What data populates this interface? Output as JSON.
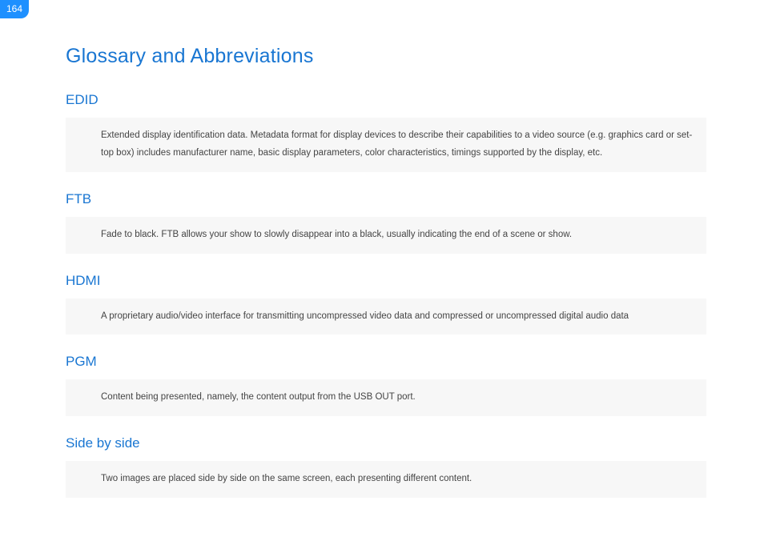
{
  "page_number": "164",
  "title": "Glossary and Abbreviations",
  "entries": [
    {
      "term": "EDID",
      "definition": "Extended display identification data. Metadata format for display devices to describe their capabilities to a video source (e.g. graphics card or set-top box) includes manufacturer name, basic display parameters, color characteristics, timings supported by the display, etc."
    },
    {
      "term": "FTB",
      "definition": "Fade to black. FTB allows your show to slowly disappear into a black, usually indicating the end of a scene or show."
    },
    {
      "term": "HDMI",
      "definition": "A proprietary audio/video interface for transmitting uncompressed video data and compressed or uncompressed digital audio data"
    },
    {
      "term": "PGM",
      "definition": "Content being presented, namely, the content output from the USB OUT port."
    },
    {
      "term": "Side by side",
      "definition": "Two images are placed side by side on the same screen, each presenting different content."
    }
  ]
}
